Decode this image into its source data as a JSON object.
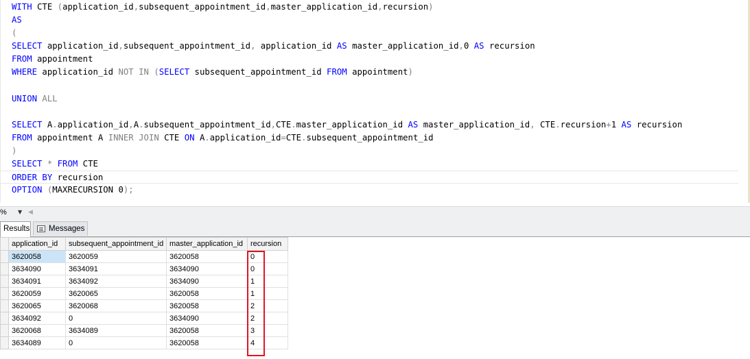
{
  "editor": {
    "lines": [
      [
        {
          "t": "WITH ",
          "c": "kw"
        },
        {
          "t": "CTE ",
          "c": ""
        },
        {
          "t": "(",
          "c": "gr"
        },
        {
          "t": "application_id",
          "c": ""
        },
        {
          "t": ",",
          "c": "gr"
        },
        {
          "t": "subsequent_appointment_id",
          "c": ""
        },
        {
          "t": ",",
          "c": "gr"
        },
        {
          "t": "master_application_id",
          "c": ""
        },
        {
          "t": ",",
          "c": "gr"
        },
        {
          "t": "recursion",
          "c": ""
        },
        {
          "t": ")",
          "c": "gr"
        }
      ],
      [
        {
          "t": "AS",
          "c": "kw"
        }
      ],
      [
        {
          "t": "(",
          "c": "gr"
        }
      ],
      [
        {
          "t": "SELECT ",
          "c": "kw"
        },
        {
          "t": "application_id",
          "c": ""
        },
        {
          "t": ",",
          "c": "gr"
        },
        {
          "t": "subsequent_appointment_id",
          "c": ""
        },
        {
          "t": ", ",
          "c": "gr"
        },
        {
          "t": "application_id ",
          "c": ""
        },
        {
          "t": "AS ",
          "c": "kw"
        },
        {
          "t": "master_application_id",
          "c": ""
        },
        {
          "t": ",",
          "c": "gr"
        },
        {
          "t": "0 ",
          "c": ""
        },
        {
          "t": "AS ",
          "c": "kw"
        },
        {
          "t": "recursion",
          "c": ""
        }
      ],
      [
        {
          "t": "FROM ",
          "c": "kw"
        },
        {
          "t": "appointment",
          "c": ""
        }
      ],
      [
        {
          "t": "WHERE ",
          "c": "kw"
        },
        {
          "t": "application_id ",
          "c": ""
        },
        {
          "t": "NOT IN ",
          "c": "gr"
        },
        {
          "t": "(",
          "c": "gr"
        },
        {
          "t": "SELECT ",
          "c": "kw"
        },
        {
          "t": "subsequent_appointment_id ",
          "c": ""
        },
        {
          "t": "FROM ",
          "c": "kw"
        },
        {
          "t": "appointment",
          "c": ""
        },
        {
          "t": ")",
          "c": "gr"
        }
      ],
      [],
      [
        {
          "t": "UNION ",
          "c": "kw"
        },
        {
          "t": "ALL",
          "c": "gr"
        }
      ],
      [],
      [
        {
          "t": "SELECT ",
          "c": "kw"
        },
        {
          "t": "A",
          "c": ""
        },
        {
          "t": ".",
          "c": "gr"
        },
        {
          "t": "application_id",
          "c": ""
        },
        {
          "t": ",",
          "c": "gr"
        },
        {
          "t": "A",
          "c": ""
        },
        {
          "t": ".",
          "c": "gr"
        },
        {
          "t": "subsequent_appointment_id",
          "c": ""
        },
        {
          "t": ",",
          "c": "gr"
        },
        {
          "t": "CTE",
          "c": ""
        },
        {
          "t": ".",
          "c": "gr"
        },
        {
          "t": "master_application_id ",
          "c": ""
        },
        {
          "t": "AS ",
          "c": "kw"
        },
        {
          "t": "master_application_id",
          "c": ""
        },
        {
          "t": ", ",
          "c": "gr"
        },
        {
          "t": "CTE",
          "c": ""
        },
        {
          "t": ".",
          "c": "gr"
        },
        {
          "t": "recursion",
          "c": ""
        },
        {
          "t": "+",
          "c": "gr"
        },
        {
          "t": "1 ",
          "c": ""
        },
        {
          "t": "AS ",
          "c": "kw"
        },
        {
          "t": "recursion",
          "c": ""
        }
      ],
      [
        {
          "t": "FROM ",
          "c": "kw"
        },
        {
          "t": "appointment A ",
          "c": ""
        },
        {
          "t": "INNER JOIN ",
          "c": "gr"
        },
        {
          "t": "CTE ",
          "c": ""
        },
        {
          "t": "ON ",
          "c": "kw"
        },
        {
          "t": "A",
          "c": ""
        },
        {
          "t": ".",
          "c": "gr"
        },
        {
          "t": "application_id",
          "c": ""
        },
        {
          "t": "=",
          "c": "gr"
        },
        {
          "t": "CTE",
          "c": ""
        },
        {
          "t": ".",
          "c": "gr"
        },
        {
          "t": "subsequent_appointment_id",
          "c": ""
        }
      ],
      [
        {
          "t": ")",
          "c": "gr"
        }
      ],
      [
        {
          "t": "SELECT ",
          "c": "kw"
        },
        {
          "t": "* ",
          "c": "gr"
        },
        {
          "t": "FROM ",
          "c": "kw"
        },
        {
          "t": "CTE",
          "c": ""
        }
      ],
      [
        {
          "t": "ORDER BY ",
          "c": "kw"
        },
        {
          "t": "recursion",
          "c": ""
        }
      ],
      [
        {
          "t": "OPTION ",
          "c": "kw"
        },
        {
          "t": "(",
          "c": "gr"
        },
        {
          "t": "MAXRECURSION 0",
          "c": ""
        },
        {
          "t": ");",
          "c": "gr"
        }
      ]
    ]
  },
  "zoom": {
    "value": "%"
  },
  "tabs": {
    "results": "Results",
    "messages": "Messages"
  },
  "grid": {
    "columns": [
      "application_id",
      "subsequent_appointment_id",
      "master_application_id",
      "recursion"
    ],
    "rows": [
      [
        "3620058",
        "3620059",
        "3620058",
        "0"
      ],
      [
        "3634090",
        "3634091",
        "3634090",
        "0"
      ],
      [
        "3634091",
        "3634092",
        "3634090",
        "1"
      ],
      [
        "3620059",
        "3620065",
        "3620058",
        "1"
      ],
      [
        "3620065",
        "3620068",
        "3620058",
        "2"
      ],
      [
        "3634092",
        "0",
        "3634090",
        "2"
      ],
      [
        "3620068",
        "3634089",
        "3620058",
        "3"
      ],
      [
        "3634089",
        "0",
        "3620058",
        "4"
      ]
    ]
  },
  "highlight_color": "#e0141e"
}
